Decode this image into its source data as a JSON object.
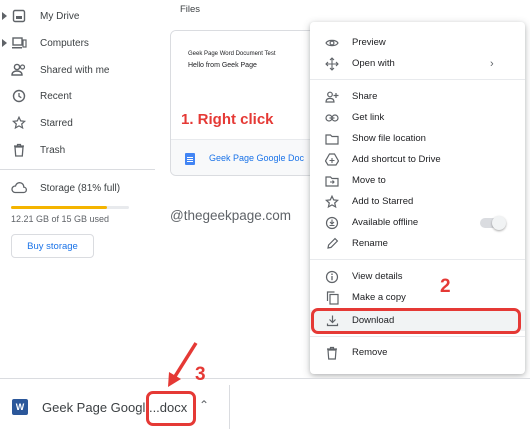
{
  "sidebar": {
    "items": [
      {
        "label": "My Drive",
        "icon": "drive-icon",
        "expandable": true
      },
      {
        "label": "Computers",
        "icon": "computer-icon",
        "expandable": true
      },
      {
        "label": "Shared with me",
        "icon": "people-icon",
        "expandable": false
      },
      {
        "label": "Recent",
        "icon": "clock-icon",
        "expandable": false
      },
      {
        "label": "Starred",
        "icon": "star-icon",
        "expandable": false
      },
      {
        "label": "Trash",
        "icon": "trash-icon",
        "expandable": false
      }
    ],
    "storage_label": "Storage (81% full)",
    "storage_percent": 81,
    "storage_used": "12.21 GB of 15 GB used",
    "buy_storage": "Buy storage"
  },
  "main": {
    "heading": "Files",
    "file_card": {
      "preview_title": "Geek Page Word Document Test",
      "preview_body": "Hello from Geek Page",
      "name": "Geek Page Google Doc"
    },
    "watermark": "@thegeekpage.com"
  },
  "context_menu": {
    "items": [
      {
        "label": "Preview",
        "icon": "eye-icon"
      },
      {
        "label": "Open with",
        "icon": "open-with-icon",
        "submenu": true
      },
      {
        "label": "Share",
        "icon": "person-add-icon"
      },
      {
        "label": "Get link",
        "icon": "link-icon"
      },
      {
        "label": "Show file location",
        "icon": "folder-icon"
      },
      {
        "label": "Add shortcut to Drive",
        "icon": "drive-shortcut-icon"
      },
      {
        "label": "Move to",
        "icon": "move-to-icon"
      },
      {
        "label": "Add to Starred",
        "icon": "star-icon"
      },
      {
        "label": "Available offline",
        "icon": "offline-icon",
        "toggle": false
      },
      {
        "label": "Rename",
        "icon": "pencil-icon"
      },
      {
        "label": "View details",
        "icon": "info-icon"
      },
      {
        "label": "Make a copy",
        "icon": "copy-icon"
      },
      {
        "label": "Download",
        "icon": "download-icon"
      },
      {
        "label": "Remove",
        "icon": "trash-icon"
      }
    ]
  },
  "download_bar": {
    "file_name": "Geek Page Googl....docx",
    "file_icon": "word-icon",
    "file_icon_letter": "W"
  },
  "annotations": {
    "step1": "1. Right click",
    "step2": "2",
    "step3": "3",
    "color": "#e53935"
  }
}
